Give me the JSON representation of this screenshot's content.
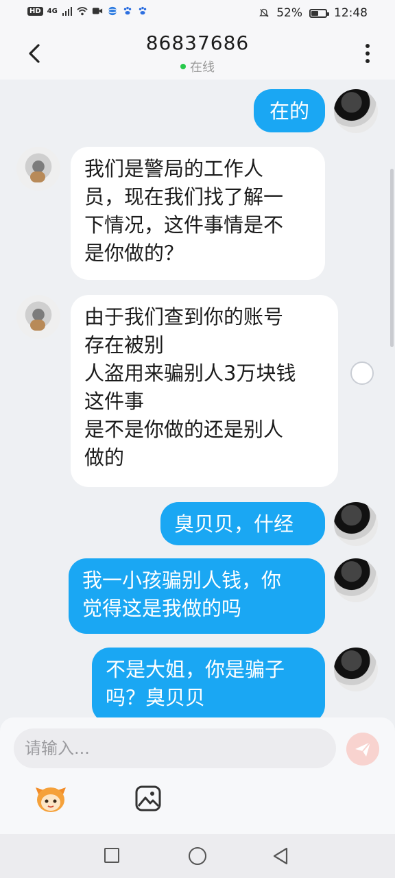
{
  "status_bar": {
    "network_badge": "HD",
    "network_type": "4G",
    "battery_percent": "52%",
    "battery_level": 0.52,
    "time": "12:48"
  },
  "header": {
    "title": "86837686",
    "status": "在线",
    "status_color": "#27c94b"
  },
  "messages": [
    {
      "sender": "me",
      "text": "在的"
    },
    {
      "sender": "other",
      "text": "我们是警局的工作人\n员，现在我们找了解一\n下情况，这件事情是不\n是你做的？"
    },
    {
      "sender": "other",
      "text": "由于我们查到你的账号\n存在被别\n人盗用来骗别人3万块钱\n这件事\n是不是你做的还是别人\n做的"
    },
    {
      "sender": "me",
      "text": "臭贝贝，什经"
    },
    {
      "sender": "me",
      "text": "我一小孩骗别人钱，你\n觉得这是我做的吗"
    },
    {
      "sender": "me",
      "text": "不是大姐，你是骗子\n吗？臭贝贝"
    }
  ],
  "composer": {
    "placeholder": "请输入..."
  },
  "colors": {
    "my_bubble": "#1aa7f3",
    "other_bubble": "#ffffff",
    "send_button": "#f8d3cf"
  }
}
